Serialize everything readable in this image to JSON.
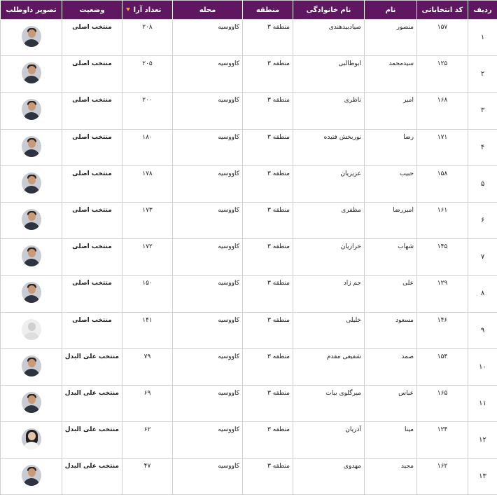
{
  "headers": {
    "index": "ردیف",
    "code": "کد انتخاباتی",
    "first_name": "نام",
    "last_name": "نام خانوادگی",
    "region": "منطقه",
    "district": "محله",
    "votes": "تعداد آرا",
    "status": "وضعیت",
    "photo": "تصویر داوطلب"
  },
  "colors": {
    "header_bg": "#5e1760",
    "status_main": "#1d9e1d",
    "status_alternate": "#1e7fd0",
    "sort_arrow": "#f2a51a"
  },
  "sort_icon": "sort-desc-icon",
  "rows": [
    {
      "index": "۱",
      "code": "۱۵۷",
      "first_name": "منصور",
      "last_name": "صیادبیدهندی",
      "region": "منطقه ۳",
      "district": "کاووسیه",
      "votes": "۲۰۸",
      "status": "منتخب اصلی",
      "status_type": "main",
      "photo": "candidate-photo"
    },
    {
      "index": "۲",
      "code": "۱۲۵",
      "first_name": "سیدمحمد",
      "last_name": "ابوطالبی",
      "region": "منطقه ۳",
      "district": "کاووسیه",
      "votes": "۲۰۵",
      "status": "منتخب اصلی",
      "status_type": "main",
      "photo": "candidate-photo"
    },
    {
      "index": "۳",
      "code": "۱۶۸",
      "first_name": "امیر",
      "last_name": "ناظری",
      "region": "منطقه ۳",
      "district": "کاووسیه",
      "votes": "۲۰۰",
      "status": "منتخب اصلی",
      "status_type": "main",
      "photo": "candidate-photo"
    },
    {
      "index": "۴",
      "code": "۱۷۱",
      "first_name": "رضا",
      "last_name": "نوربخش فتیده",
      "region": "منطقه ۳",
      "district": "کاووسیه",
      "votes": "۱۸۰",
      "status": "منتخب اصلی",
      "status_type": "main",
      "photo": "candidate-photo"
    },
    {
      "index": "۵",
      "code": "۱۵۸",
      "first_name": "حبیب",
      "last_name": "عزیزیان",
      "region": "منطقه ۳",
      "district": "کاووسیه",
      "votes": "۱۷۸",
      "status": "منتخب اصلی",
      "status_type": "main",
      "photo": "candidate-photo"
    },
    {
      "index": "۶",
      "code": "۱۶۱",
      "first_name": "امیررضا",
      "last_name": "مظفری",
      "region": "منطقه ۳",
      "district": "کاووسیه",
      "votes": "۱۷۳",
      "status": "منتخب اصلی",
      "status_type": "main",
      "photo": "candidate-photo"
    },
    {
      "index": "۷",
      "code": "۱۴۵",
      "first_name": "شهاب",
      "last_name": "خرازیان",
      "region": "منطقه ۳",
      "district": "کاووسیه",
      "votes": "۱۷۲",
      "status": "منتخب اصلی",
      "status_type": "main",
      "photo": "candidate-photo"
    },
    {
      "index": "۸",
      "code": "۱۲۹",
      "first_name": "علی",
      "last_name": "جم زاد",
      "region": "منطقه ۳",
      "district": "کاووسیه",
      "votes": "۱۵۰",
      "status": "منتخب اصلی",
      "status_type": "main",
      "photo": "candidate-photo"
    },
    {
      "index": "۹",
      "code": "۱۴۶",
      "first_name": "مسعود",
      "last_name": "خلیلی",
      "region": "منطقه ۳",
      "district": "کاووسیه",
      "votes": "۱۴۱",
      "status": "منتخب اصلی",
      "status_type": "main",
      "photo": "placeholder-photo"
    },
    {
      "index": "۱۰",
      "code": "۱۵۴",
      "first_name": "صمد",
      "last_name": "شفیعی مقدم",
      "region": "منطقه ۳",
      "district": "کاووسیه",
      "votes": "۷۹",
      "status": "منتخب علی البدل",
      "status_type": "alternate",
      "photo": "candidate-photo"
    },
    {
      "index": "۱۱",
      "code": "۱۶۵",
      "first_name": "عباس",
      "last_name": "میرگلوی بیات",
      "region": "منطقه ۳",
      "district": "کاووسیه",
      "votes": "۶۹",
      "status": "منتخب علی البدل",
      "status_type": "alternate",
      "photo": "candidate-photo"
    },
    {
      "index": "۱۲",
      "code": "۱۲۴",
      "first_name": "مینا",
      "last_name": "آذریان",
      "region": "منطقه ۳",
      "district": "کاووسیه",
      "votes": "۶۲",
      "status": "منتخب علی البدل",
      "status_type": "alternate",
      "photo": "female-candidate-photo"
    },
    {
      "index": "۱۳",
      "code": "۱۶۲",
      "first_name": "مجید",
      "last_name": "مهدوی",
      "region": "منطقه ۳",
      "district": "کاووسیه",
      "votes": "۴۷",
      "status": "منتخب علی البدل",
      "status_type": "alternate",
      "photo": "candidate-photo"
    }
  ]
}
